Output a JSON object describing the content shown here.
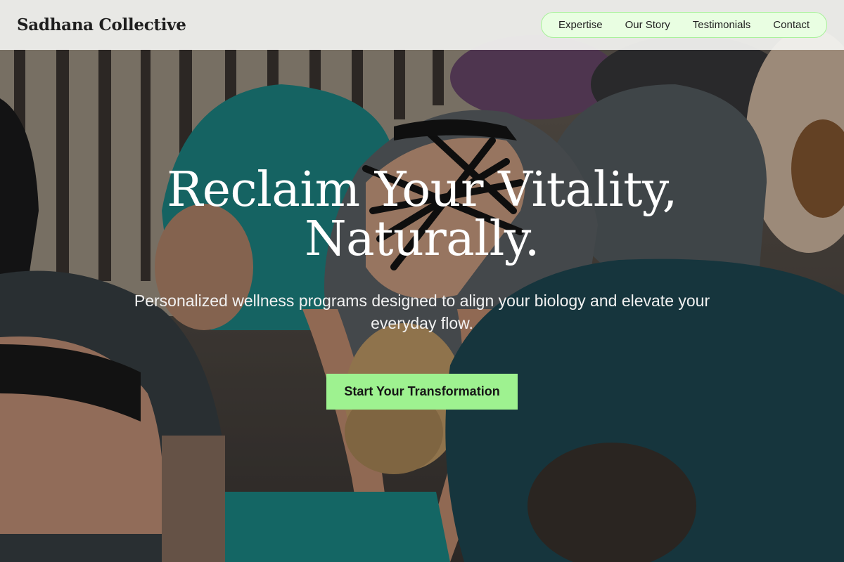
{
  "brand": {
    "name": "Sadhana Collective"
  },
  "nav": {
    "items": [
      {
        "label": "Expertise"
      },
      {
        "label": "Our Story"
      },
      {
        "label": "Testimonials"
      },
      {
        "label": "Contact"
      }
    ]
  },
  "hero": {
    "title_line1": "Reclaim Your Vitality,",
    "title_line2": "Naturally.",
    "subtitle": "Personalized wellness programs designed to align your biology and elevate your everyday flow.",
    "cta_label": "Start Your Transformation",
    "background": "yoga class in forward fold pose"
  },
  "colors": {
    "accent": "#9ef290",
    "nav_border": "#a8f09a",
    "header_bg": "#f4f4f2",
    "text_dark": "#1e1e1e"
  }
}
